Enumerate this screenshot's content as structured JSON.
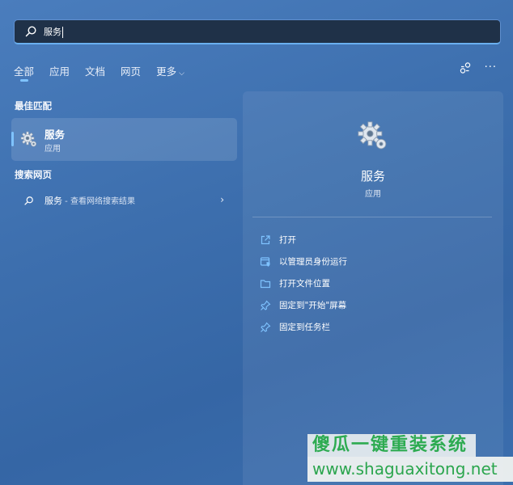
{
  "search": {
    "query": "服务"
  },
  "tabs": [
    {
      "label": "全部",
      "active": true
    },
    {
      "label": "应用"
    },
    {
      "label": "文档"
    },
    {
      "label": "网页"
    },
    {
      "label": "更多"
    }
  ],
  "topright": {
    "icons": [
      "share-network-icon",
      "more-dots-icon"
    ],
    "more_label": "···"
  },
  "best_match": {
    "section_title": "最佳匹配",
    "name": "服务",
    "type": "应用"
  },
  "web_search": {
    "section_title": "搜索网页",
    "query": "服务",
    "suffix": " - 查看网络搜索结果"
  },
  "detail": {
    "name": "服务",
    "type": "应用",
    "actions": [
      {
        "label": "打开",
        "icon": "open-external-icon"
      },
      {
        "label": "以管理员身份运行",
        "icon": "run-as-admin-icon"
      },
      {
        "label": "打开文件位置",
        "icon": "folder-icon"
      },
      {
        "label": "固定到\"开始\"屏幕",
        "icon": "pin-icon"
      },
      {
        "label": "固定到任务栏",
        "icon": "pin-icon"
      }
    ]
  },
  "watermark": {
    "line1": "傻瓜一键重装系统",
    "line2": "www.shaguaxitong.net"
  },
  "colors": {
    "accent": "#7fc3ff",
    "background": "#3d6fae",
    "search_bg": "#1f3148"
  }
}
